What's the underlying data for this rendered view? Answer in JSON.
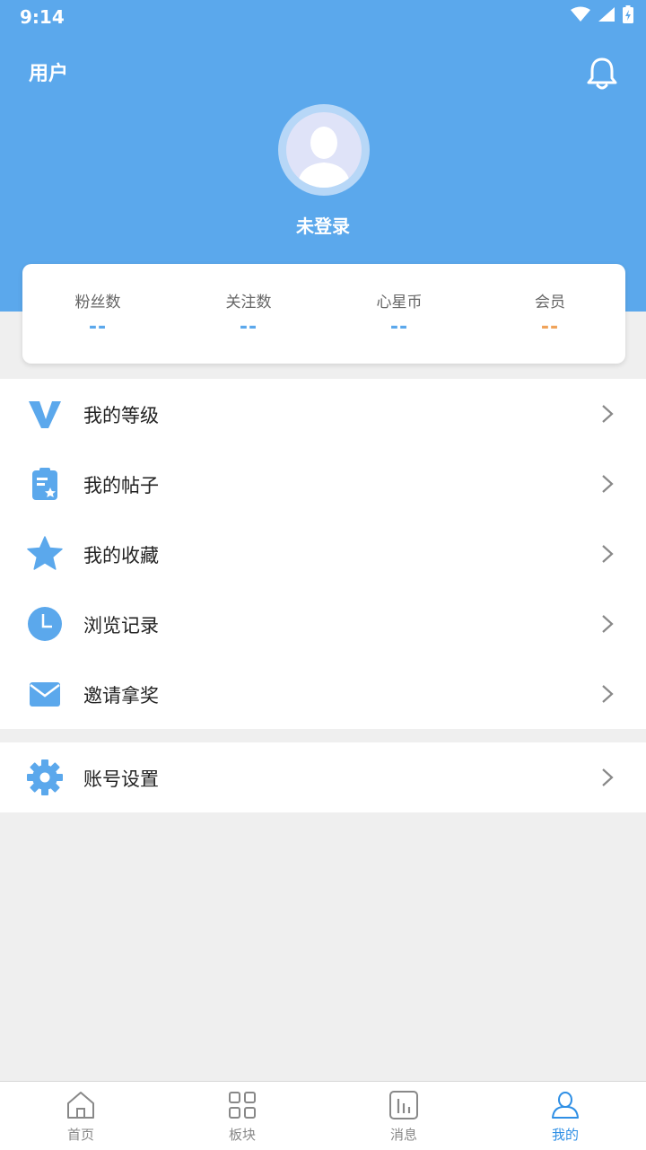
{
  "status_bar": {
    "time": "9:14"
  },
  "header": {
    "title": "用户",
    "username": "未登录"
  },
  "stats": [
    {
      "label": "粉丝数",
      "value": "--"
    },
    {
      "label": "关注数",
      "value": "--"
    },
    {
      "label": "心星币",
      "value": "--"
    },
    {
      "label": "会员",
      "value": "--"
    }
  ],
  "menu": [
    {
      "label": "我的等级",
      "icon": "v-level-icon"
    },
    {
      "label": "我的帖子",
      "icon": "clipboard-icon"
    },
    {
      "label": "我的收藏",
      "icon": "star-icon"
    },
    {
      "label": "浏览记录",
      "icon": "clock-icon"
    },
    {
      "label": "邀请拿奖",
      "icon": "mail-icon"
    }
  ],
  "settings": {
    "label": "账号设置",
    "icon": "gear-icon"
  },
  "tabs": [
    {
      "label": "首页",
      "icon": "home-icon"
    },
    {
      "label": "板块",
      "icon": "grid-icon"
    },
    {
      "label": "消息",
      "icon": "chart-icon"
    },
    {
      "label": "我的",
      "icon": "user-icon",
      "active": true
    }
  ],
  "colors": {
    "primary": "#5ba8ec",
    "accent_orange": "#f0a35a",
    "active_tab": "#2f8fe5"
  }
}
